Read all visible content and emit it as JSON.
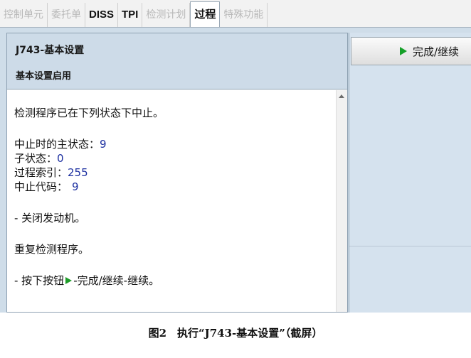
{
  "tabs": [
    {
      "label": "控制单元",
      "enabled": false
    },
    {
      "label": "委托单",
      "enabled": false
    },
    {
      "label": "DISS",
      "enabled": true
    },
    {
      "label": "TPI",
      "enabled": true
    },
    {
      "label": "检测计划",
      "enabled": false
    },
    {
      "label": "过程",
      "enabled": true,
      "active": true
    },
    {
      "label": "特殊功能",
      "enabled": false
    }
  ],
  "header": {
    "title": "J743-基本设置",
    "subtitle": "基本设置启用"
  },
  "content": {
    "line1": "检测程序已在下列状态下中止。",
    "main_state_label": "中止时的主状态：",
    "main_state_value": "9",
    "sub_state_label": "子状态：",
    "sub_state_value": "0",
    "process_index_label": "过程索引：",
    "process_index_value": "255",
    "abort_code_label": "中止代码：",
    "abort_code_value": "9",
    "instruction1": "- 关闭发动机。",
    "instruction2": "重复检测程序。",
    "instruction3_prefix": "- 按下按钮",
    "instruction3_suffix": "-完成/继续-继续。"
  },
  "right_panel": {
    "finish_button_label": "完成/继续"
  },
  "caption": "图2　执行“J743-基本设置”（截屏）",
  "colors": {
    "accent_green": "#15a028",
    "value_blue": "#1c2fa0",
    "panel_bg": "#cddbe8"
  }
}
